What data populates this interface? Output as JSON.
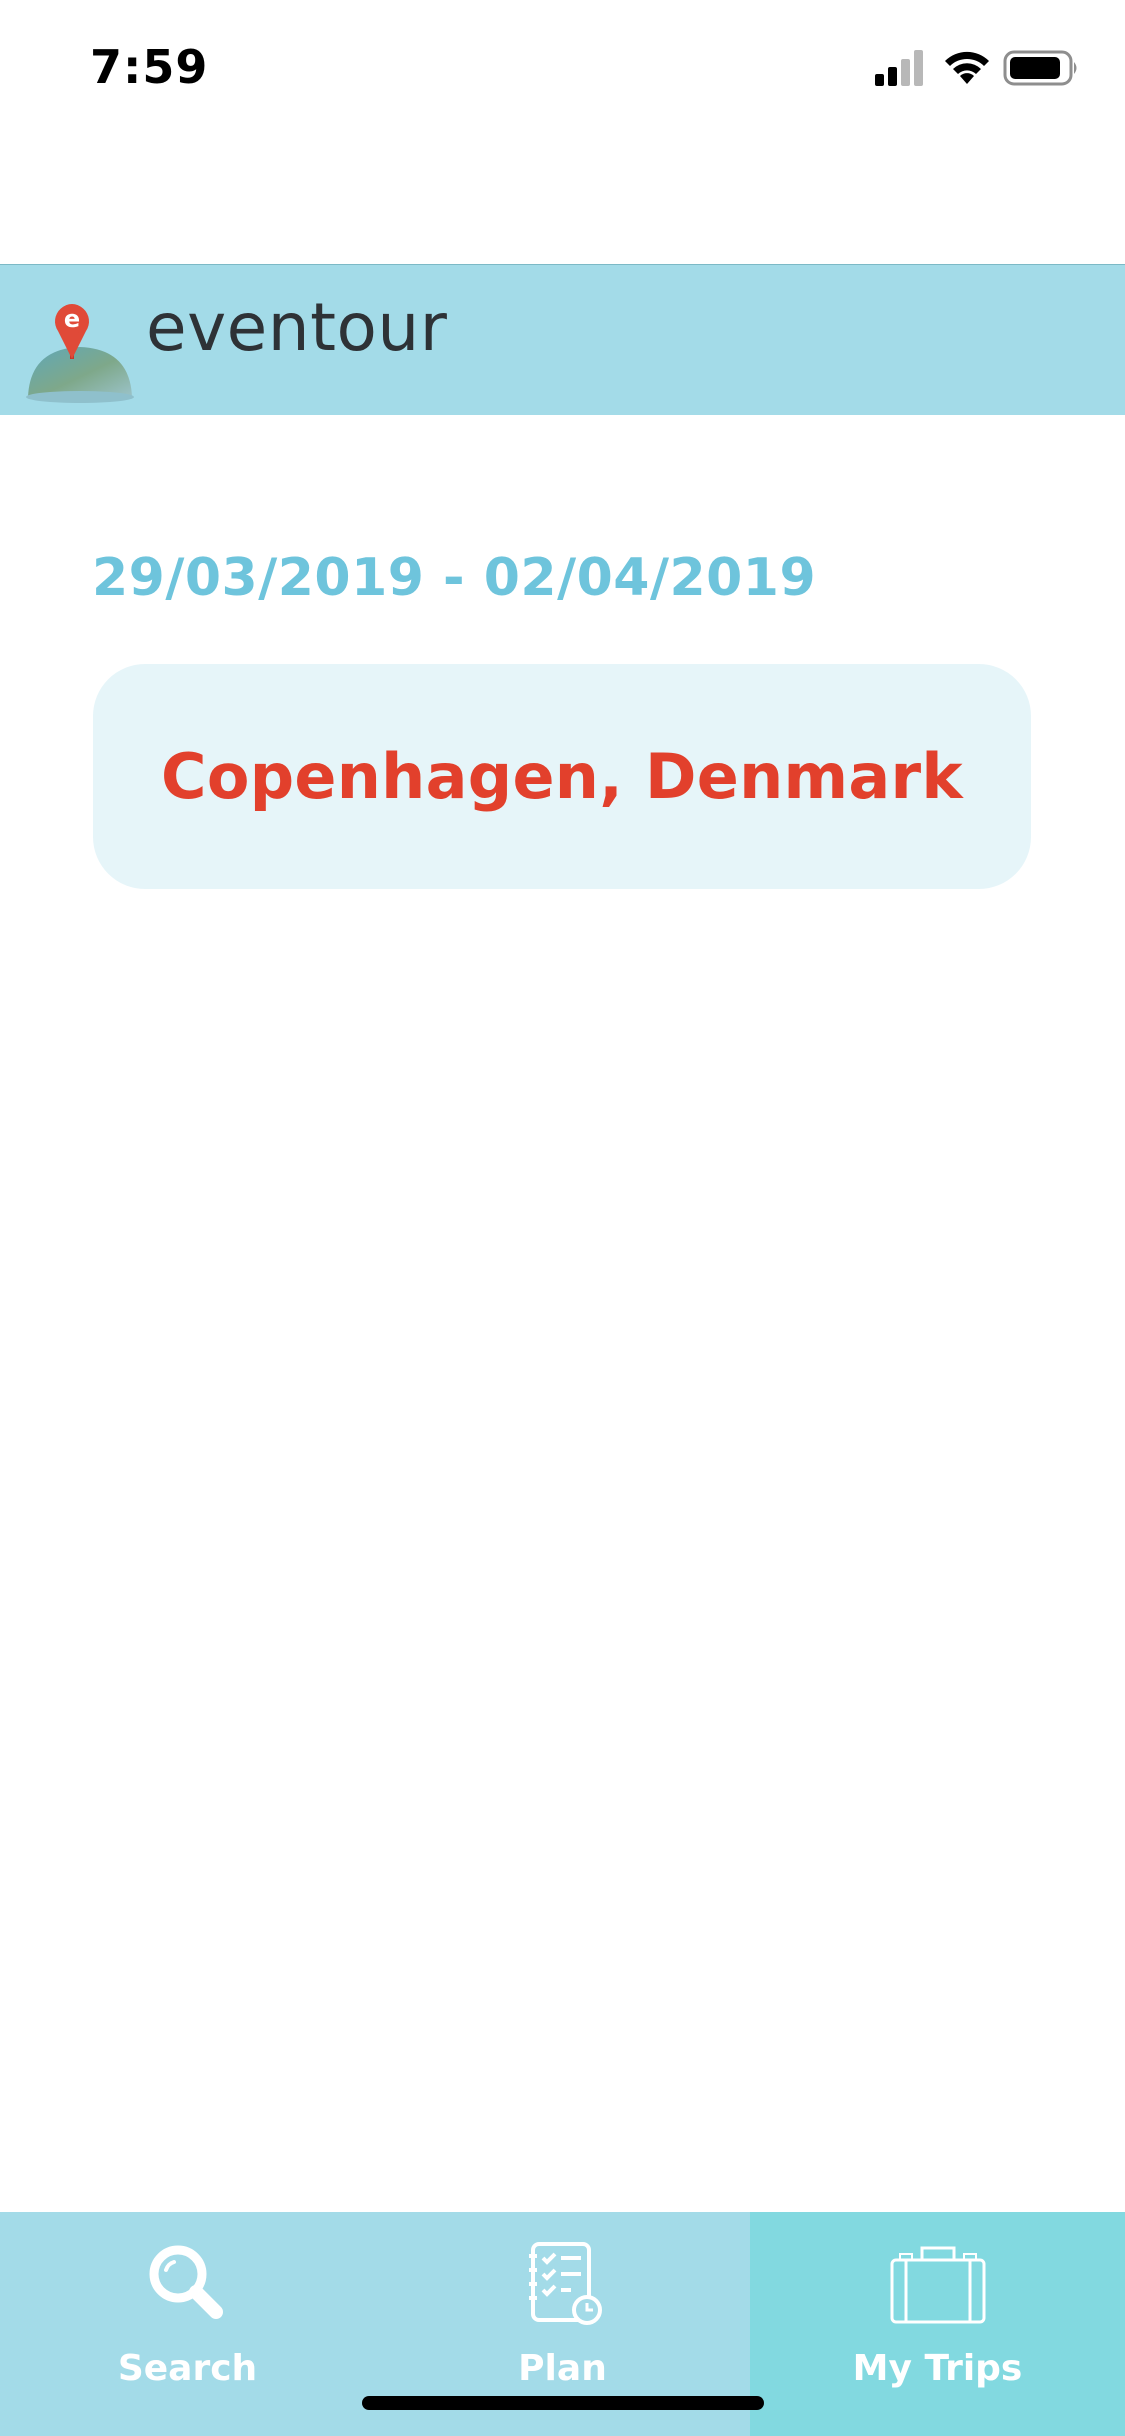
{
  "status_bar": {
    "time": "7:59"
  },
  "header": {
    "brand": "eventour",
    "logo_letter": "e"
  },
  "trip": {
    "dates": "29/03/2019 - 02/04/2019",
    "destination": "Copenhagen, Denmark"
  },
  "tabs": [
    {
      "label": "Search",
      "icon": "search-icon",
      "active": false
    },
    {
      "label": "Plan",
      "icon": "checklist-icon",
      "active": false
    },
    {
      "label": "My Trips",
      "icon": "suitcase-icon",
      "active": true
    }
  ],
  "colors": {
    "header_bg": "#a3dbe8",
    "active_tab_bg": "#82d9e0",
    "dates_text": "#6ec4dc",
    "destination_text": "#e2402c",
    "card_bg": "#e6f5f9"
  }
}
